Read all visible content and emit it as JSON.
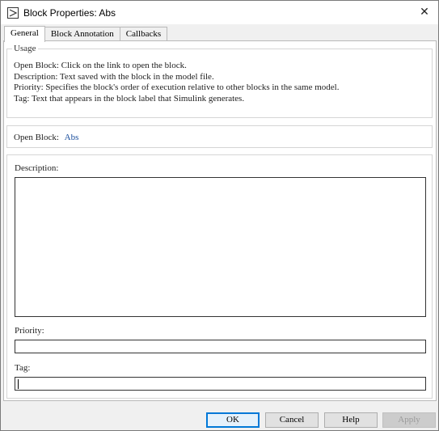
{
  "window": {
    "title": "Block Properties: Abs",
    "icon": "simulink-block-icon"
  },
  "tabs": [
    {
      "label": "General",
      "active": true
    },
    {
      "label": "Block Annotation",
      "active": false
    },
    {
      "label": "Callbacks",
      "active": false
    }
  ],
  "usage": {
    "legend": "Usage",
    "lines": [
      "Open Block: Click on the link to open the block.",
      "Description: Text saved with the block in the model file.",
      "Priority: Specifies the block's order of execution relative to other blocks in the same model.",
      "Tag: Text that appears in the block label that Simulink generates."
    ]
  },
  "open_block": {
    "label": "Open Block:",
    "link": "Abs"
  },
  "form": {
    "description_label": "Description:",
    "description_value": "",
    "priority_label": "Priority:",
    "priority_value": "",
    "tag_label": "Tag:",
    "tag_value": ""
  },
  "buttons": {
    "ok": "OK",
    "cancel": "Cancel",
    "help": "Help",
    "apply": "Apply"
  },
  "colors": {
    "link": "#1a4e9c",
    "focus": "#0078d7"
  }
}
